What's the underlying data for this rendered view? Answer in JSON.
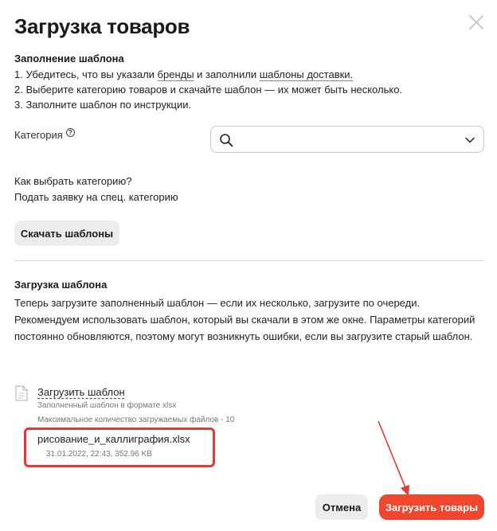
{
  "dialog": {
    "title": "Загрузка товаров"
  },
  "template_fill": {
    "heading": "Заполнение шаблона",
    "step1_prefix": "1. Убедитесь, что вы указали ",
    "step1_link1": "бренды",
    "step1_middle": " и заполнили ",
    "step1_link2": "шаблоны доставки.",
    "step2": "2. Выберите категорию товаров и скачайте шаблон — их может быть несколько.",
    "step3": "3. Заполните шаблон по инструкции."
  },
  "category": {
    "label": "Категория",
    "help_icon": "question-circle-icon",
    "select_icons": [
      "search-icon",
      "chevron-down-icon"
    ],
    "value": ""
  },
  "help_links": {
    "how_to_choose": "Как выбрать категорию?",
    "special_request": "Подать заявку на спец. категорию"
  },
  "download_button": "Скачать шаблоны",
  "upload": {
    "heading": "Загрузка шаблона",
    "description": "Теперь загрузите заполненный шаблон — если их несколько, загрузите по очереди. Рекомендуем использовать шаблон, который вы скачали в этом же окне. Параметры категорий постоянно обновляются, поэтому могут возникнуть ошибки, если вы загрузите старый шаблон.",
    "link": "Загрузить шаблон",
    "hint_format": "Заполненный шаблон в формате xlsx",
    "hint_max": "Максимальное количество загружаемых файлов - 10",
    "file": {
      "name": "рисование_и_каллиграфия.xlsx",
      "meta": "31.01.2022, 22:43, 352.96 KB"
    }
  },
  "footer": {
    "cancel": "Отмена",
    "submit": "Загрузить товары"
  },
  "colors": {
    "accent": "#f0452f",
    "highlight": "#e53935"
  }
}
